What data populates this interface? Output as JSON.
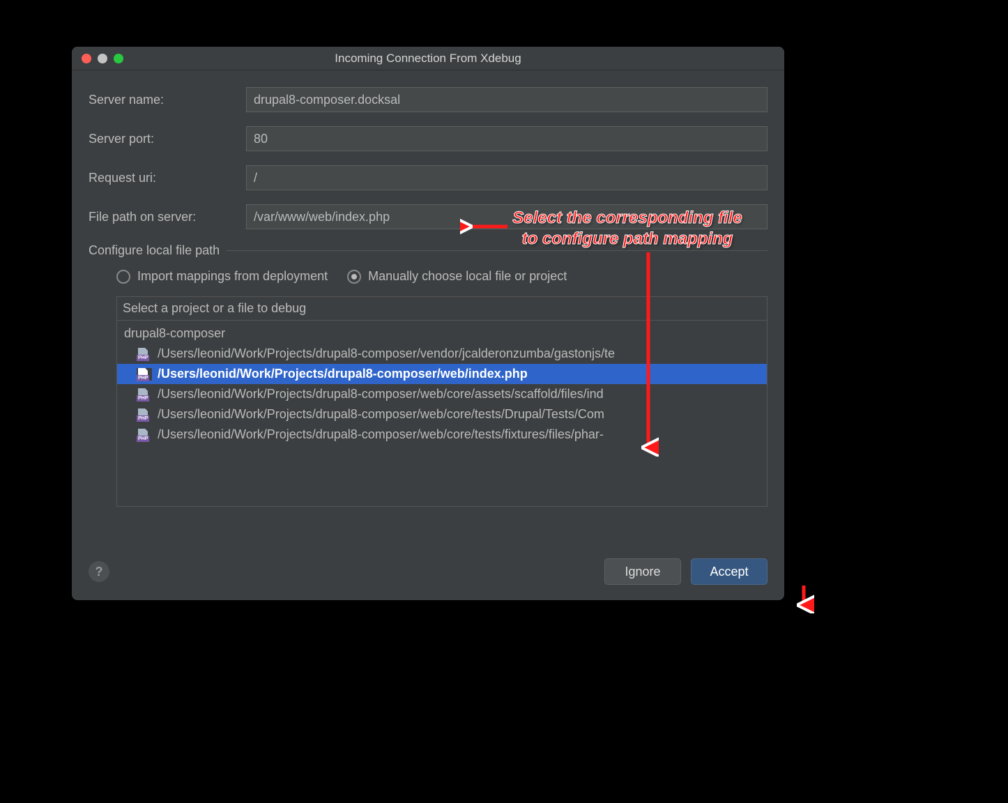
{
  "dialog": {
    "title": "Incoming Connection From Xdebug",
    "fields": {
      "server_name_label": "Server name:",
      "server_name_value": "drupal8-composer.docksal",
      "server_port_label": "Server port:",
      "server_port_value": "80",
      "request_uri_label": "Request uri:",
      "request_uri_value": "/",
      "file_path_label": "File path on server:",
      "file_path_value": "/var/www/web/index.php"
    },
    "section_title": "Configure local file path",
    "radios": {
      "import_label": "Import mappings from deployment",
      "manual_label": "Manually choose local file or project",
      "selected": "manual"
    },
    "tree": {
      "header": "Select a project or a file to debug",
      "root": "drupal8-composer",
      "items": [
        {
          "path": "/Users/leonid/Work/Projects/drupal8-composer/vendor/jcalderonzumba/gastonjs/te",
          "selected": false
        },
        {
          "path": "/Users/leonid/Work/Projects/drupal8-composer/web/index.php",
          "selected": true
        },
        {
          "path": "/Users/leonid/Work/Projects/drupal8-composer/web/core/assets/scaffold/files/ind",
          "selected": false
        },
        {
          "path": "/Users/leonid/Work/Projects/drupal8-composer/web/core/tests/Drupal/Tests/Com",
          "selected": false
        },
        {
          "path": "/Users/leonid/Work/Projects/drupal8-composer/web/core/tests/fixtures/files/phar-",
          "selected": false
        }
      ]
    },
    "buttons": {
      "help": "?",
      "ignore": "Ignore",
      "accept": "Accept"
    }
  },
  "annotation": {
    "line1": "Select the corresponding file",
    "line2": "to configure path mapping"
  }
}
